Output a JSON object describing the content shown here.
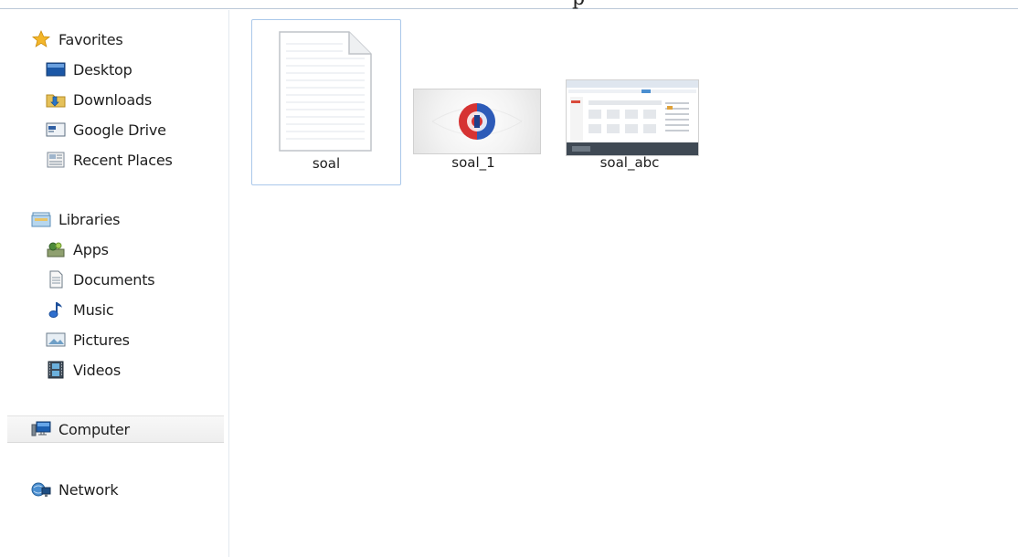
{
  "window": {
    "title_fragment": "p"
  },
  "nav": {
    "favorites": {
      "label": "Favorites",
      "items": [
        {
          "label": "Desktop",
          "icon": "desktop-icon"
        },
        {
          "label": "Downloads",
          "icon": "downloads-folder-icon"
        },
        {
          "label": "Google Drive",
          "icon": "google-drive-icon"
        },
        {
          "label": "Recent Places",
          "icon": "recent-places-icon"
        }
      ]
    },
    "libraries": {
      "label": "Libraries",
      "items": [
        {
          "label": "Apps",
          "icon": "apps-icon"
        },
        {
          "label": "Documents",
          "icon": "documents-icon"
        },
        {
          "label": "Music",
          "icon": "music-icon"
        },
        {
          "label": "Pictures",
          "icon": "pictures-icon"
        },
        {
          "label": "Videos",
          "icon": "videos-icon"
        }
      ]
    },
    "computer": {
      "label": "Computer",
      "selected": true
    },
    "network": {
      "label": "Network"
    }
  },
  "files": [
    {
      "name": "soal",
      "type": "blank-document",
      "selected": true
    },
    {
      "name": "soal_1",
      "type": "image-emblem",
      "selected": false
    },
    {
      "name": "soal_abc",
      "type": "screenshot-image",
      "selected": false
    }
  ],
  "colors": {
    "selection_border": "#aac8ea",
    "selected_nav_bg": "#eeeeee",
    "favorites_star": "#f3b62a"
  }
}
